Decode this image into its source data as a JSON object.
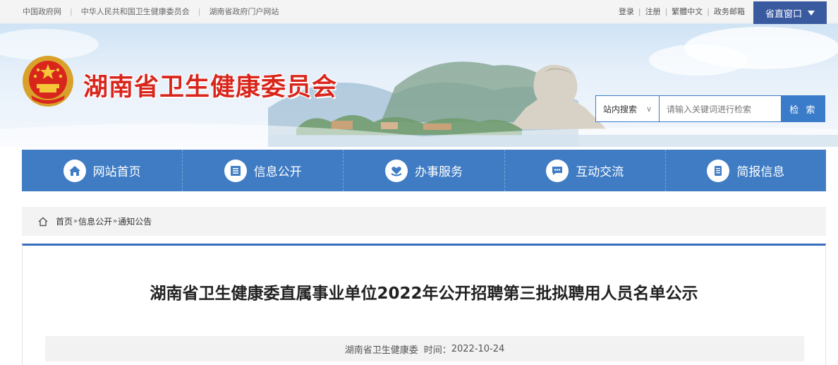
{
  "topbar": {
    "links": [
      "中国政府网",
      "中华人民共和国卫生健康委员会",
      "湖南省政府门户网站"
    ],
    "right_links": [
      "登录",
      "注册",
      "繁體中文",
      "政务邮箱"
    ],
    "window_button": "省直窗口"
  },
  "header": {
    "site_title": "湖南省卫生健康委员会"
  },
  "search": {
    "scope": "站内搜索",
    "scope_arrow": "∨",
    "placeholder": "请输入关键词进行检索",
    "button": "检 索"
  },
  "nav": {
    "items": [
      {
        "label": "网站首页",
        "icon": "home-icon"
      },
      {
        "label": "信息公开",
        "icon": "document-icon"
      },
      {
        "label": "办事服务",
        "icon": "heart-hands-icon"
      },
      {
        "label": "互动交流",
        "icon": "chat-icon"
      },
      {
        "label": "简报信息",
        "icon": "report-icon"
      }
    ]
  },
  "breadcrumb": {
    "items": [
      "首页",
      "信息公开",
      "通知公告"
    ],
    "separator": "»"
  },
  "article": {
    "title": "湖南省卫生健康委直属事业单位2022年公开招聘第三批拟聘用人员名单公示",
    "source": "湖南省卫生健康委",
    "time_label": "时间：",
    "time": "2022-10-24"
  },
  "colors": {
    "brand_red": "#d9261c",
    "nav_blue": "#3f7cc4",
    "window_btn": "#3a5aa0"
  }
}
